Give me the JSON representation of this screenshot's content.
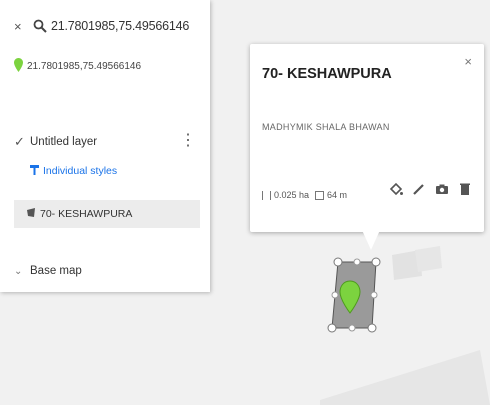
{
  "search": {
    "query": "21.7801985,75.49566146"
  },
  "result": {
    "coordinates": "21.7801985,75.49566146"
  },
  "layer": {
    "name": "Untitled layer",
    "styles_label": "Individual styles",
    "feature_name": "70- KESHAWPURA"
  },
  "basemap": {
    "label": "Base map"
  },
  "popup": {
    "title": "70- KESHAWPURA",
    "description": "MADHYMIK SHALA BHAWAN",
    "area": "0.025 ha",
    "perimeter": "64 m"
  },
  "colors": {
    "marker": "#7cd33f",
    "polygon": "#9a9a9a",
    "accent": "#1a73e8"
  },
  "icons": [
    "close-icon",
    "search-icon",
    "location-pin-icon",
    "checkbox-icon",
    "more-vert-icon",
    "paint-bucket-icon",
    "polygon-icon",
    "chevron-icon",
    "edit-icon",
    "camera-icon",
    "trash-icon"
  ]
}
